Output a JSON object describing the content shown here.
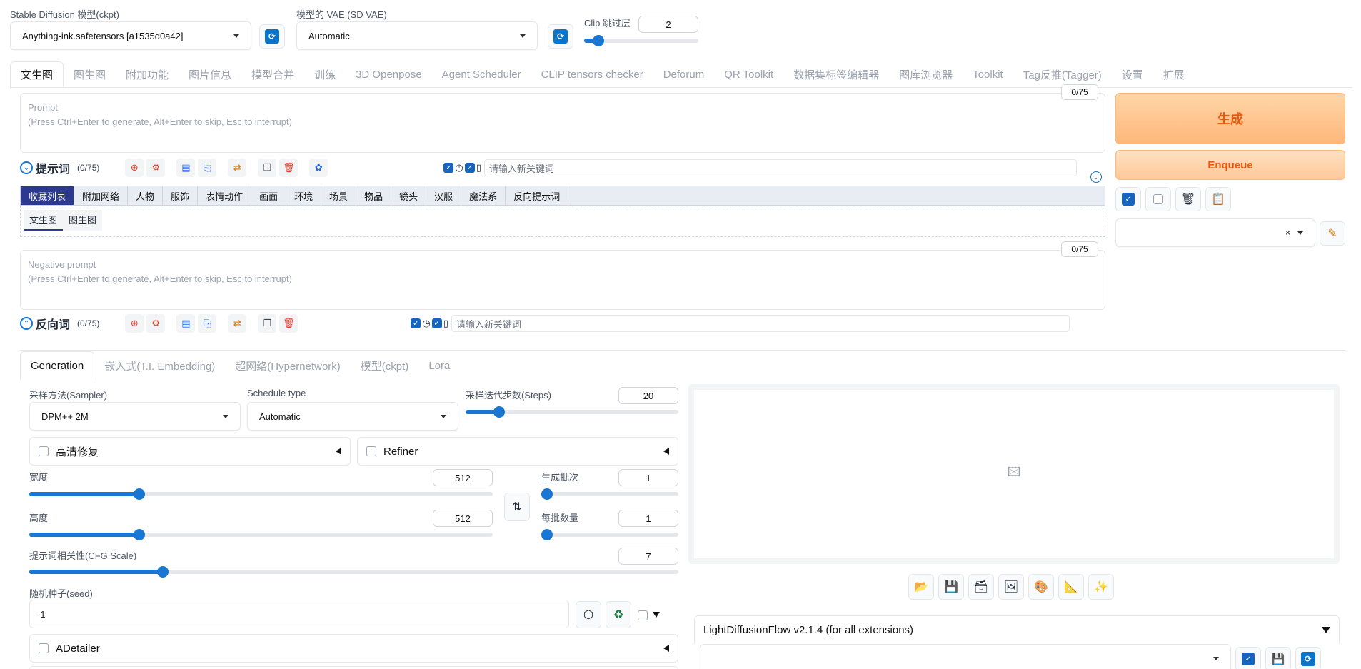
{
  "header": {
    "ckpt_label": "Stable Diffusion 模型(ckpt)",
    "ckpt_value": "Anything-ink.safetensors [a1535d0a42]",
    "vae_label": "模型的 VAE (SD VAE)",
    "vae_value": "Automatic",
    "clip_label": "Clip 跳过层",
    "clip_value": "2",
    "clip_fraction": 0.08,
    "refresh_icon": "refresh-icon"
  },
  "main_tabs": [
    "文生图",
    "图生图",
    "附加功能",
    "图片信息",
    "模型合并",
    "训练",
    "3D Openpose",
    "Agent Scheduler",
    "CLIP tensors checker",
    "Deforum",
    "QR Toolkit",
    "数据集标签编辑器",
    "图库浏览器",
    "Toolkit",
    "Tag反推(Tagger)",
    "设置",
    "扩展"
  ],
  "prompt": {
    "label": "Prompt",
    "placeholder": "(Press Ctrl+Enter to generate, Alt+Enter to skip, Esc to interrupt)",
    "counter": "0/75",
    "section_title": "提示词",
    "section_count": "(0/75)",
    "keyword_placeholder": "请输入新关键词"
  },
  "categories": [
    "收藏列表",
    "附加网络",
    "人物",
    "服饰",
    "表情动作",
    "画面",
    "环境",
    "场景",
    "物品",
    "镜头",
    "汉服",
    "魔法系",
    "反向提示词"
  ],
  "subtabs": [
    "文生图",
    "图生图"
  ],
  "negative": {
    "label": "Negative prompt",
    "placeholder": "(Press Ctrl+Enter to generate, Alt+Enter to skip, Esc to interrupt)",
    "counter": "0/75",
    "section_title": "反向词",
    "section_count": "(0/75)",
    "keyword_placeholder": "请输入新关键词"
  },
  "actions": {
    "generate": "生成",
    "enqueue": "Enqueue"
  },
  "gen_tabs": [
    "Generation",
    "嵌入式(T.I. Embedding)",
    "超网络(Hypernetwork)",
    "模型(ckpt)",
    "Lora"
  ],
  "params": {
    "sampler_label": "采样方法(Sampler)",
    "sampler_value": "DPM++ 2M",
    "schedule_label": "Schedule type",
    "schedule_value": "Automatic",
    "steps_label": "采样迭代步数(Steps)",
    "steps_value": "20",
    "steps_fraction": 0.14,
    "hires_label": "高清修复",
    "refiner_label": "Refiner",
    "width_label": "宽度",
    "width_value": "512",
    "width_fraction": 0.23,
    "height_label": "高度",
    "height_value": "512",
    "height_fraction": 0.23,
    "batch_count_label": "生成批次",
    "batch_count_value": "1",
    "batch_count_fraction": 0.0,
    "batch_size_label": "每批数量",
    "batch_size_value": "1",
    "batch_size_fraction": 0.0,
    "cfg_label": "提示词相关性(CFG Scale)",
    "cfg_value": "7",
    "cfg_fraction": 0.2,
    "seed_label": "随机种子(seed)",
    "seed_value": "-1",
    "adetailer_label": "ADetailer"
  },
  "output": {
    "ldf_title": "LightDiffusionFlow v2.1.4 (for all extensions)"
  }
}
